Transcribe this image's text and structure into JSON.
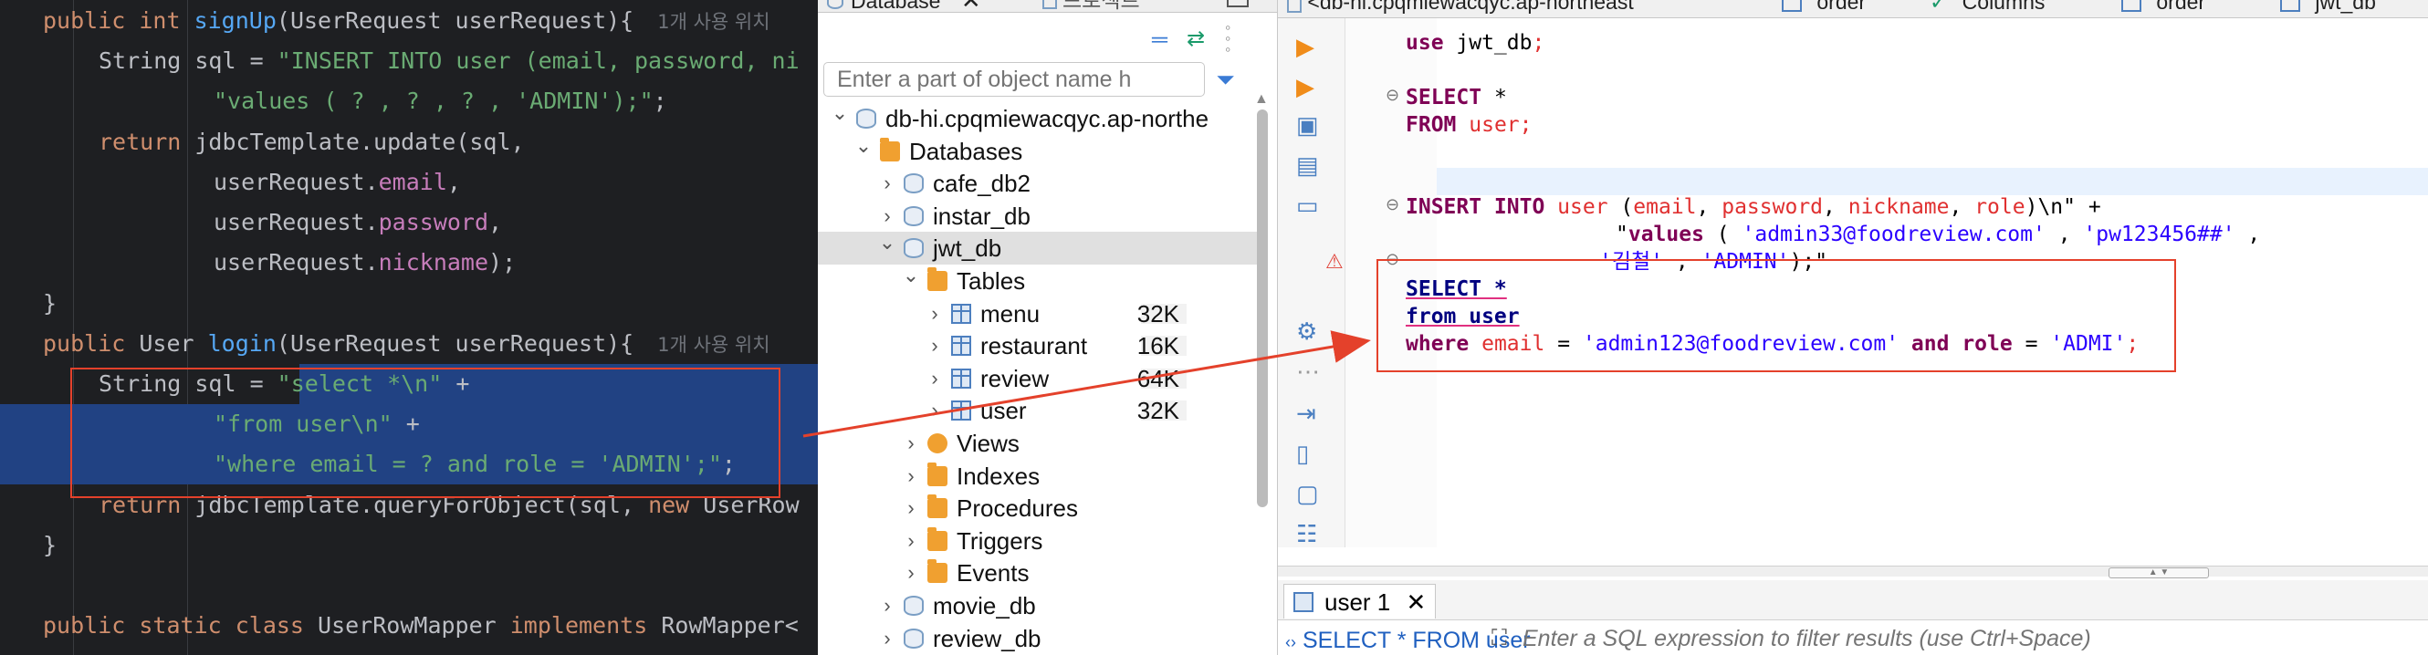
{
  "ide": {
    "lines": [
      {
        "t": [
          [
            "kw",
            "public "
          ],
          [
            "kw",
            "int "
          ],
          [
            "fn",
            "signUp"
          ],
          [
            "plain",
            "(UserRequest userRequest){"
          ]
        ],
        "hint": "1개 사용 위치"
      },
      {
        "t": [
          [
            "plain",
            "String sql = "
          ],
          [
            "str",
            "\"INSERT INTO user (email, password, ni"
          ]
        ]
      },
      {
        "t": [
          [
            "str",
            "\"values ( ? , ? , ? , 'ADMIN');\""
          ],
          [
            "plain",
            ";"
          ]
        ]
      },
      {
        "t": [
          [
            "kw",
            "return "
          ],
          [
            "plain",
            "jdbcTemplate.update(sql,"
          ]
        ]
      },
      {
        "t": [
          [
            "plain",
            "userRequest."
          ],
          [
            "fld",
            "email"
          ],
          [
            "plain",
            ","
          ]
        ]
      },
      {
        "t": [
          [
            "plain",
            "userRequest."
          ],
          [
            "fld",
            "password"
          ],
          [
            "plain",
            ","
          ]
        ]
      },
      {
        "t": [
          [
            "plain",
            "userRequest."
          ],
          [
            "fld",
            "nickname"
          ],
          [
            "plain",
            ");"
          ]
        ]
      },
      {
        "t": [
          [
            "plain",
            "}"
          ]
        ]
      },
      {
        "t": [
          [
            "kw",
            "public "
          ],
          [
            "plain",
            "User "
          ],
          [
            "fn",
            "login"
          ],
          [
            "plain",
            "(UserRequest userRequest){"
          ]
        ],
        "hint": "1개 사용 위치"
      },
      {
        "t": [
          [
            "plain",
            "String sql = "
          ],
          [
            "str",
            "\"select *\\n\""
          ],
          [
            "plain",
            " +"
          ]
        ]
      },
      {
        "t": [
          [
            "str",
            "\"from user\\n\""
          ],
          [
            "plain",
            " +"
          ]
        ]
      },
      {
        "t": [
          [
            "str",
            "\"where email = ? and role = 'ADMIN';\""
          ],
          [
            "plain",
            ";"
          ]
        ]
      },
      {
        "t": [
          [
            "kw",
            "return "
          ],
          [
            "plain",
            "jdbcTemplate.queryForObject(sql, "
          ],
          [
            "kw",
            "new "
          ],
          [
            "plain",
            "UserRow"
          ]
        ]
      },
      {
        "t": [
          [
            "plain",
            "}"
          ]
        ]
      },
      {
        "t": []
      },
      {
        "t": [
          [
            "kw",
            "public static class "
          ],
          [
            "plain",
            "UserRowMapper "
          ],
          [
            "kw",
            "implements "
          ],
          [
            "plain",
            "RowMapper<"
          ]
        ]
      }
    ]
  },
  "navigator": {
    "tab_label": "Database",
    "tab_close": "✕",
    "other_tab_label": "프로젝트",
    "search_placeholder": "Enter a part of object name h",
    "tree": [
      {
        "label": "db-hi.cpqmiewacqyc.ap-northe",
        "icon": "connection",
        "level": 0,
        "chev": "down"
      },
      {
        "label": "Databases",
        "icon": "folder",
        "level": 1,
        "chev": "down"
      },
      {
        "label": "cafe_db2",
        "icon": "database",
        "level": 2,
        "chev": "right"
      },
      {
        "label": "instar_db",
        "icon": "database",
        "level": 2,
        "chev": "right"
      },
      {
        "label": "jwt_db",
        "icon": "database",
        "level": 2,
        "chev": "down",
        "selected": true
      },
      {
        "label": "Tables",
        "icon": "folder",
        "level": 3,
        "chev": "down"
      },
      {
        "label": "menu",
        "icon": "table",
        "level": 4,
        "chev": "right",
        "size": "32K"
      },
      {
        "label": "restaurant",
        "icon": "table",
        "level": 4,
        "chev": "right",
        "size": "16K"
      },
      {
        "label": "review",
        "icon": "table",
        "level": 4,
        "chev": "right",
        "size": "64K"
      },
      {
        "label": "user",
        "icon": "table",
        "level": 4,
        "chev": "right",
        "size": "32K"
      },
      {
        "label": "Views",
        "icon": "views",
        "level": 3,
        "chev": "right"
      },
      {
        "label": "Indexes",
        "icon": "folder",
        "level": 3,
        "chev": "right"
      },
      {
        "label": "Procedures",
        "icon": "folder",
        "level": 3,
        "chev": "right"
      },
      {
        "label": "Triggers",
        "icon": "folder",
        "level": 3,
        "chev": "right"
      },
      {
        "label": "Events",
        "icon": "folder",
        "level": 3,
        "chev": "right"
      },
      {
        "label": "movie_db",
        "icon": "database",
        "level": 2,
        "chev": "right"
      },
      {
        "label": "review_db",
        "icon": "database",
        "level": 2,
        "chev": "right"
      }
    ]
  },
  "sql_editor": {
    "tabs": [
      "<db-hi.cpqmiewacqyc.ap-northeast",
      "order",
      "Columns",
      "order",
      "jwt_db"
    ],
    "lines": [
      {
        "row": 0,
        "t": [
          [
            "skw",
            "use "
          ],
          [
            "sid",
            "jwt_db"
          ],
          [
            "sred",
            ";"
          ]
        ]
      },
      {
        "row": 2,
        "t": [
          [
            "skw",
            "SELECT "
          ],
          [
            "sid",
            "*"
          ]
        ]
      },
      {
        "row": 3,
        "t": [
          [
            "skw",
            "FROM "
          ],
          [
            "sred",
            "user"
          ],
          [
            "sred",
            ";"
          ]
        ]
      },
      {
        "row": 6,
        "t": [
          [
            "skw",
            "INSERT INTO "
          ],
          [
            "sred",
            "user "
          ],
          [
            "sid",
            "("
          ],
          [
            "sred",
            "email"
          ],
          [
            "sid",
            ", "
          ],
          [
            "sred",
            "password"
          ],
          [
            "sid",
            ", "
          ],
          [
            "sred",
            "nickname"
          ],
          [
            "sid",
            ", "
          ],
          [
            "sred",
            "role"
          ],
          [
            "sid",
            ")\\n\" +"
          ]
        ]
      },
      {
        "row": 7,
        "indent": true,
        "t": [
          [
            "sid",
            "\""
          ],
          [
            "skw",
            "values "
          ],
          [
            "sid",
            "( "
          ],
          [
            "sstr",
            "'admin33@foodreview.com'"
          ],
          [
            "sid",
            " , "
          ],
          [
            "sstr",
            "'pw123456##'"
          ],
          [
            "sid",
            " ,"
          ]
        ]
      },
      {
        "row": 8,
        "indent2": true,
        "t": [
          [
            "sstr",
            "'김철'"
          ],
          [
            "sid",
            " , "
          ],
          [
            "sstr",
            "'ADMIN'"
          ],
          [
            "sid",
            ");\""
          ]
        ]
      },
      {
        "row": 9,
        "t": [
          [
            "skw-u",
            "SELECT *"
          ]
        ]
      },
      {
        "row": 10,
        "t": [
          [
            "skw-u",
            "from user"
          ]
        ]
      },
      {
        "row": 11,
        "t": [
          [
            "skw",
            "where "
          ],
          [
            "sred",
            "email "
          ],
          [
            "sid",
            "= "
          ],
          [
            "sstr",
            "'admin123@foodreview.com'"
          ],
          [
            "skw",
            " and "
          ],
          [
            "skw",
            "role "
          ],
          [
            "sid",
            "= "
          ],
          [
            "sstr",
            "'ADMI'"
          ],
          [
            "sred",
            ";"
          ]
        ]
      }
    ],
    "result_tab_label": "user 1",
    "result_tab_close": "✕",
    "filter_query": "SELECT * FROM user",
    "filter_placeholder": "Enter a SQL expression to filter results (use Ctrl+Space)"
  },
  "colors": {
    "ide_bg": "#1e1f22",
    "selection": "#214283",
    "annotation_red": "#e4412b"
  }
}
